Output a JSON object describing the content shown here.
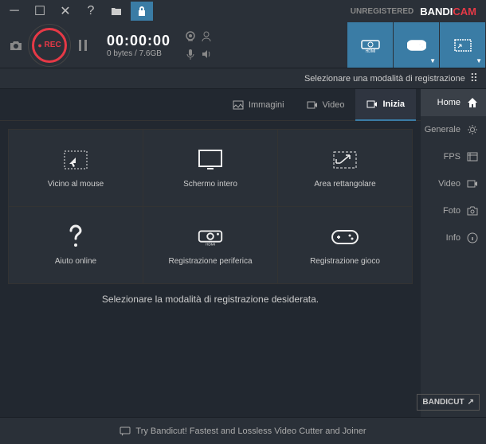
{
  "brand": {
    "part1": "BANDI",
    "part2": "CAM"
  },
  "unregistered": "UNREGISTERED",
  "rec_label": "REC",
  "timer": "00:00:00",
  "bytes": "0 bytes / 7.6GB",
  "subheader": "Selezionare una modalità di registrazione",
  "sidebar": {
    "items": [
      {
        "label": "Home"
      },
      {
        "label": "Generale"
      },
      {
        "label": "FPS"
      },
      {
        "label": "Video"
      },
      {
        "label": "Foto"
      },
      {
        "label": "Info"
      }
    ]
  },
  "tabs": {
    "inizia": "Inizia",
    "video": "Video",
    "immagini": "Immagini"
  },
  "modes": {
    "area": "Area rettangolare",
    "schermo": "Schermo intero",
    "mouse": "Vicino al mouse",
    "gioco": "Registrazione gioco",
    "periferica": "Registrazione periferica",
    "aiuto": "Aiuto online"
  },
  "instruction": "Selezionare la modalità di registrazione desiderata.",
  "bandicut": "BANDICUT",
  "footer": "Try Bandicut! Fastest and Lossless Video Cutter and Joiner"
}
